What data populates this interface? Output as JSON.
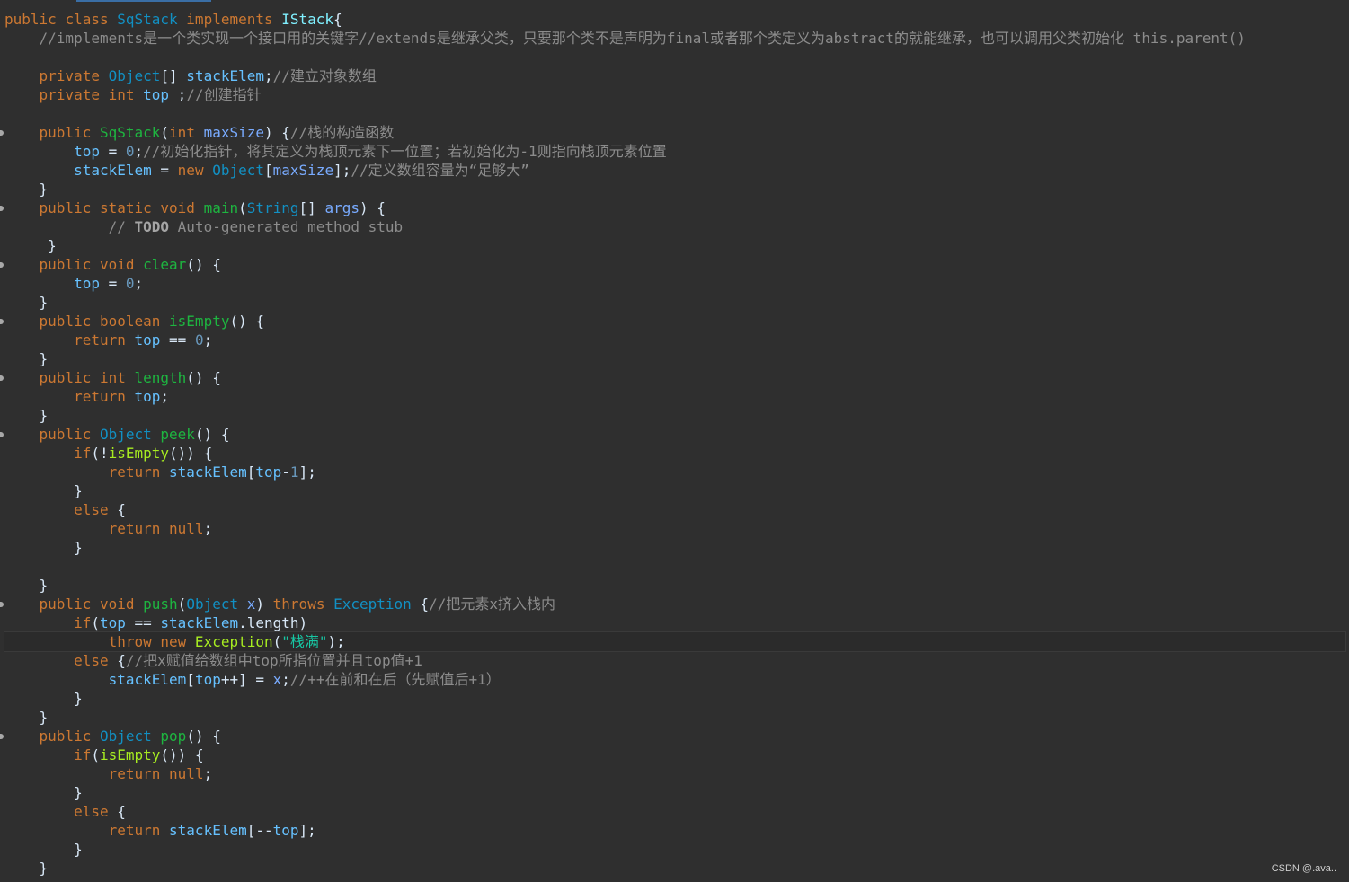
{
  "editor": {
    "watermark": "CSDN @.ava..",
    "colors": {
      "background": "#2f2f2f",
      "keyword": "#cc7832",
      "type": "#6897bb",
      "method": "#60c060",
      "field": "#66c1ff",
      "plain": "#d9e8f7",
      "comment": "#8c8c8c",
      "string": "#17c6a3",
      "number": "#6897bb",
      "todo": "#a5a5a5"
    }
  },
  "lines": [
    {
      "fold": false,
      "current": false,
      "tokens": [
        {
          "t": "public ",
          "c": "#cc7832"
        },
        {
          "t": "class ",
          "c": "#cc7832"
        },
        {
          "t": "SqStack ",
          "c": "#1290c3"
        },
        {
          "t": "implements ",
          "c": "#cc7832"
        },
        {
          "t": "IStack",
          "c": "#80f0ff"
        },
        {
          "t": "{",
          "c": "#d9e8f7"
        }
      ]
    },
    {
      "fold": false,
      "current": false,
      "tokens": [
        {
          "t": "    //implements是一个类实现一个接口用的关键字//extends是继承父类，只要那个类不是声明为final或者那个类定义为abstract的就能继承，也可以调用父类初始化 this.parent()",
          "c": "#8c8c8c"
        }
      ]
    },
    {
      "fold": false,
      "current": false,
      "tokens": [
        {
          "t": " ",
          "c": "#d9e8f7"
        }
      ]
    },
    {
      "fold": false,
      "current": false,
      "tokens": [
        {
          "t": "    private ",
          "c": "#cc7832"
        },
        {
          "t": "Object",
          "c": "#1290c3"
        },
        {
          "t": "[] ",
          "c": "#d9e8f7"
        },
        {
          "t": "stackElem",
          "c": "#66c1ff"
        },
        {
          "t": ";",
          "c": "#d9e8f7"
        },
        {
          "t": "//建立对象数组",
          "c": "#8c8c8c"
        }
      ]
    },
    {
      "fold": false,
      "current": false,
      "tokens": [
        {
          "t": "    private ",
          "c": "#cc7832"
        },
        {
          "t": "int ",
          "c": "#cc7832"
        },
        {
          "t": "top ",
          "c": "#66c1ff"
        },
        {
          "t": ";",
          "c": "#d9e8f7"
        },
        {
          "t": "//创建指针",
          "c": "#8c8c8c"
        }
      ]
    },
    {
      "fold": false,
      "current": false,
      "tokens": [
        {
          "t": " ",
          "c": "#d9e8f7"
        }
      ]
    },
    {
      "fold": true,
      "current": false,
      "tokens": [
        {
          "t": "    public ",
          "c": "#cc7832"
        },
        {
          "t": "SqStack",
          "c": "#1eb540"
        },
        {
          "t": "(",
          "c": "#d9e8f7"
        },
        {
          "t": "int ",
          "c": "#cc7832"
        },
        {
          "t": "maxSize",
          "c": "#79abff"
        },
        {
          "t": ") {",
          "c": "#d9e8f7"
        },
        {
          "t": "//栈的构造函数",
          "c": "#8c8c8c"
        }
      ]
    },
    {
      "fold": false,
      "current": false,
      "tokens": [
        {
          "t": "        top",
          "c": "#66c1ff"
        },
        {
          "t": " = ",
          "c": "#d9e8f7"
        },
        {
          "t": "0",
          "c": "#6897bb"
        },
        {
          "t": ";",
          "c": "#d9e8f7"
        },
        {
          "t": "//初始化指针，将其定义为栈顶元素下一位置；若初始化为-1则指向栈顶元素位置",
          "c": "#8c8c8c"
        }
      ]
    },
    {
      "fold": false,
      "current": false,
      "tokens": [
        {
          "t": "        stackElem",
          "c": "#66c1ff"
        },
        {
          "t": " = ",
          "c": "#d9e8f7"
        },
        {
          "t": "new ",
          "c": "#cc7832"
        },
        {
          "t": "Object",
          "c": "#1290c3"
        },
        {
          "t": "[",
          "c": "#d9e8f7"
        },
        {
          "t": "maxSize",
          "c": "#79abff"
        },
        {
          "t": "];",
          "c": "#d9e8f7"
        },
        {
          "t": "//定义数组容量为“足够大”",
          "c": "#8c8c8c"
        }
      ]
    },
    {
      "fold": false,
      "current": false,
      "tokens": [
        {
          "t": "    }",
          "c": "#d9e8f7"
        }
      ]
    },
    {
      "fold": true,
      "current": false,
      "tokens": [
        {
          "t": "    public ",
          "c": "#cc7832"
        },
        {
          "t": "static ",
          "c": "#cc7832"
        },
        {
          "t": "void ",
          "c": "#cc7832"
        },
        {
          "t": "main",
          "c": "#1eb540"
        },
        {
          "t": "(",
          "c": "#d9e8f7"
        },
        {
          "t": "String",
          "c": "#1290c3"
        },
        {
          "t": "[] ",
          "c": "#d9e8f7"
        },
        {
          "t": "args",
          "c": "#79abff"
        },
        {
          "t": ") {",
          "c": "#d9e8f7"
        }
      ]
    },
    {
      "fold": false,
      "current": false,
      "tokens": [
        {
          "t": "            // ",
          "c": "#8c8c8c"
        },
        {
          "t": "TODO",
          "c": "#a5a5a5",
          "b": true
        },
        {
          "t": " Auto-generated method stub",
          "c": "#8c8c8c"
        }
      ]
    },
    {
      "fold": false,
      "current": false,
      "tokens": [
        {
          "t": "     }",
          "c": "#d9e8f7"
        }
      ]
    },
    {
      "fold": true,
      "current": false,
      "tokens": [
        {
          "t": "    public ",
          "c": "#cc7832"
        },
        {
          "t": "void ",
          "c": "#cc7832"
        },
        {
          "t": "clear",
          "c": "#1eb540"
        },
        {
          "t": "() {",
          "c": "#d9e8f7"
        }
      ]
    },
    {
      "fold": false,
      "current": false,
      "tokens": [
        {
          "t": "        top",
          "c": "#66c1ff"
        },
        {
          "t": " = ",
          "c": "#d9e8f7"
        },
        {
          "t": "0",
          "c": "#6897bb"
        },
        {
          "t": ";",
          "c": "#d9e8f7"
        }
      ]
    },
    {
      "fold": false,
      "current": false,
      "tokens": [
        {
          "t": "    }",
          "c": "#d9e8f7"
        }
      ]
    },
    {
      "fold": true,
      "current": false,
      "tokens": [
        {
          "t": "    public ",
          "c": "#cc7832"
        },
        {
          "t": "boolean ",
          "c": "#cc7832"
        },
        {
          "t": "isEmpty",
          "c": "#1eb540"
        },
        {
          "t": "() {",
          "c": "#d9e8f7"
        }
      ]
    },
    {
      "fold": false,
      "current": false,
      "tokens": [
        {
          "t": "        return ",
          "c": "#cc7832"
        },
        {
          "t": "top",
          "c": "#66c1ff"
        },
        {
          "t": " == ",
          "c": "#d9e8f7"
        },
        {
          "t": "0",
          "c": "#6897bb"
        },
        {
          "t": ";",
          "c": "#d9e8f7"
        }
      ]
    },
    {
      "fold": false,
      "current": false,
      "tokens": [
        {
          "t": "    }",
          "c": "#d9e8f7"
        }
      ]
    },
    {
      "fold": true,
      "current": false,
      "tokens": [
        {
          "t": "    public ",
          "c": "#cc7832"
        },
        {
          "t": "int ",
          "c": "#cc7832"
        },
        {
          "t": "length",
          "c": "#1eb540"
        },
        {
          "t": "() {",
          "c": "#d9e8f7"
        }
      ]
    },
    {
      "fold": false,
      "current": false,
      "tokens": [
        {
          "t": "        return ",
          "c": "#cc7832"
        },
        {
          "t": "top",
          "c": "#66c1ff"
        },
        {
          "t": ";",
          "c": "#d9e8f7"
        }
      ]
    },
    {
      "fold": false,
      "current": false,
      "tokens": [
        {
          "t": "    }",
          "c": "#d9e8f7"
        }
      ]
    },
    {
      "fold": true,
      "current": false,
      "tokens": [
        {
          "t": "    public ",
          "c": "#cc7832"
        },
        {
          "t": "Object ",
          "c": "#1290c3"
        },
        {
          "t": "peek",
          "c": "#1eb540"
        },
        {
          "t": "() {",
          "c": "#d9e8f7"
        }
      ]
    },
    {
      "fold": false,
      "current": false,
      "tokens": [
        {
          "t": "        if",
          "c": "#cc7832"
        },
        {
          "t": "(!",
          "c": "#d9e8f7"
        },
        {
          "t": "isEmpty",
          "c": "#a7ec21"
        },
        {
          "t": "()) {",
          "c": "#d9e8f7"
        }
      ]
    },
    {
      "fold": false,
      "current": false,
      "tokens": [
        {
          "t": "            return ",
          "c": "#cc7832"
        },
        {
          "t": "stackElem",
          "c": "#66c1ff"
        },
        {
          "t": "[",
          "c": "#d9e8f7"
        },
        {
          "t": "top",
          "c": "#66c1ff"
        },
        {
          "t": "-",
          "c": "#d9e8f7"
        },
        {
          "t": "1",
          "c": "#6897bb"
        },
        {
          "t": "];",
          "c": "#d9e8f7"
        }
      ]
    },
    {
      "fold": false,
      "current": false,
      "tokens": [
        {
          "t": "        }",
          "c": "#d9e8f7"
        }
      ]
    },
    {
      "fold": false,
      "current": false,
      "tokens": [
        {
          "t": "        else ",
          "c": "#cc7832"
        },
        {
          "t": "{",
          "c": "#d9e8f7"
        }
      ]
    },
    {
      "fold": false,
      "current": false,
      "tokens": [
        {
          "t": "            return ",
          "c": "#cc7832"
        },
        {
          "t": "null",
          "c": "#cc7832"
        },
        {
          "t": ";",
          "c": "#d9e8f7"
        }
      ]
    },
    {
      "fold": false,
      "current": false,
      "tokens": [
        {
          "t": "        }",
          "c": "#d9e8f7"
        }
      ]
    },
    {
      "fold": false,
      "current": false,
      "tokens": [
        {
          "t": " ",
          "c": "#d9e8f7"
        }
      ]
    },
    {
      "fold": false,
      "current": false,
      "tokens": [
        {
          "t": "    }",
          "c": "#d9e8f7"
        }
      ]
    },
    {
      "fold": true,
      "current": false,
      "tokens": [
        {
          "t": "    public ",
          "c": "#cc7832"
        },
        {
          "t": "void ",
          "c": "#cc7832"
        },
        {
          "t": "push",
          "c": "#1eb540"
        },
        {
          "t": "(",
          "c": "#d9e8f7"
        },
        {
          "t": "Object ",
          "c": "#1290c3"
        },
        {
          "t": "x",
          "c": "#79abff"
        },
        {
          "t": ") ",
          "c": "#d9e8f7"
        },
        {
          "t": "throws ",
          "c": "#cc7832"
        },
        {
          "t": "Exception ",
          "c": "#1290c3"
        },
        {
          "t": "{",
          "c": "#d9e8f7"
        },
        {
          "t": "//把元素x挤入栈内",
          "c": "#8c8c8c"
        }
      ]
    },
    {
      "fold": false,
      "current": false,
      "tokens": [
        {
          "t": "        if",
          "c": "#cc7832"
        },
        {
          "t": "(",
          "c": "#d9e8f7"
        },
        {
          "t": "top",
          "c": "#66c1ff"
        },
        {
          "t": " == ",
          "c": "#d9e8f7"
        },
        {
          "t": "stackElem",
          "c": "#66c1ff"
        },
        {
          "t": ".",
          "c": "#d9e8f7"
        },
        {
          "t": "length",
          "c": "#d9e8f7"
        },
        {
          "t": ")",
          "c": "#d9e8f7"
        }
      ]
    },
    {
      "fold": false,
      "current": true,
      "tokens": [
        {
          "t": "            throw ",
          "c": "#cc7832"
        },
        {
          "t": "new ",
          "c": "#cc7832"
        },
        {
          "t": "Exception",
          "c": "#a7ec21"
        },
        {
          "t": "(",
          "c": "#d9e8f7"
        },
        {
          "t": "\"栈满\"",
          "c": "#17c6a3"
        },
        {
          "t": ");",
          "c": "#d9e8f7"
        }
      ]
    },
    {
      "fold": false,
      "current": false,
      "tokens": [
        {
          "t": "        else ",
          "c": "#cc7832"
        },
        {
          "t": "{",
          "c": "#d9e8f7"
        },
        {
          "t": "//把x赋值给数组中top所指位置并且top值+1",
          "c": "#8c8c8c"
        }
      ]
    },
    {
      "fold": false,
      "current": false,
      "tokens": [
        {
          "t": "            stackElem",
          "c": "#66c1ff"
        },
        {
          "t": "[",
          "c": "#d9e8f7"
        },
        {
          "t": "top",
          "c": "#66c1ff"
        },
        {
          "t": "++] = ",
          "c": "#d9e8f7"
        },
        {
          "t": "x",
          "c": "#79abff"
        },
        {
          "t": ";",
          "c": "#d9e8f7"
        },
        {
          "t": "//++在前和在后（先赋值后+1）",
          "c": "#8c8c8c"
        }
      ]
    },
    {
      "fold": false,
      "current": false,
      "tokens": [
        {
          "t": "        }",
          "c": "#d9e8f7"
        }
      ]
    },
    {
      "fold": false,
      "current": false,
      "tokens": [
        {
          "t": "    }",
          "c": "#d9e8f7"
        }
      ]
    },
    {
      "fold": true,
      "current": false,
      "tokens": [
        {
          "t": "    public ",
          "c": "#cc7832"
        },
        {
          "t": "Object ",
          "c": "#1290c3"
        },
        {
          "t": "pop",
          "c": "#1eb540"
        },
        {
          "t": "() {",
          "c": "#d9e8f7"
        }
      ]
    },
    {
      "fold": false,
      "current": false,
      "tokens": [
        {
          "t": "        if",
          "c": "#cc7832"
        },
        {
          "t": "(",
          "c": "#d9e8f7"
        },
        {
          "t": "isEmpty",
          "c": "#a7ec21"
        },
        {
          "t": "()) {",
          "c": "#d9e8f7"
        }
      ]
    },
    {
      "fold": false,
      "current": false,
      "tokens": [
        {
          "t": "            return ",
          "c": "#cc7832"
        },
        {
          "t": "null",
          "c": "#cc7832"
        },
        {
          "t": ";",
          "c": "#d9e8f7"
        }
      ]
    },
    {
      "fold": false,
      "current": false,
      "tokens": [
        {
          "t": "        }",
          "c": "#d9e8f7"
        }
      ]
    },
    {
      "fold": false,
      "current": false,
      "tokens": [
        {
          "t": "        else ",
          "c": "#cc7832"
        },
        {
          "t": "{",
          "c": "#d9e8f7"
        }
      ]
    },
    {
      "fold": false,
      "current": false,
      "tokens": [
        {
          "t": "            return ",
          "c": "#cc7832"
        },
        {
          "t": "stackElem",
          "c": "#66c1ff"
        },
        {
          "t": "[--",
          "c": "#d9e8f7"
        },
        {
          "t": "top",
          "c": "#66c1ff"
        },
        {
          "t": "];",
          "c": "#d9e8f7"
        }
      ]
    },
    {
      "fold": false,
      "current": false,
      "tokens": [
        {
          "t": "        }",
          "c": "#d9e8f7"
        }
      ]
    },
    {
      "fold": false,
      "current": false,
      "tokens": [
        {
          "t": "    }",
          "c": "#d9e8f7"
        }
      ]
    }
  ]
}
